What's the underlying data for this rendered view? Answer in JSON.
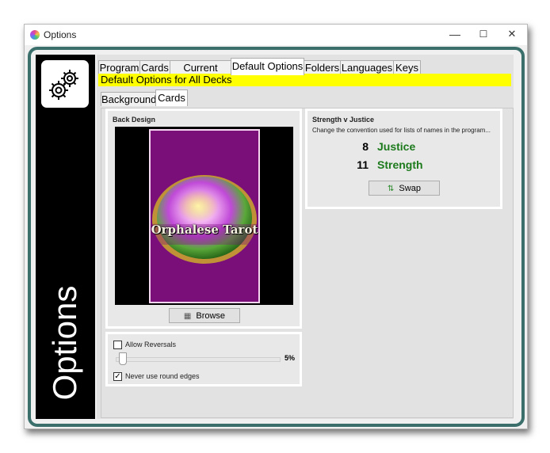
{
  "window": {
    "title": "Options"
  },
  "sidebar": {
    "title": "Options"
  },
  "tabs": [
    "Program",
    "Cards",
    "Current Deck",
    "Default Options",
    "Folders",
    "Languages",
    "Keys"
  ],
  "active_tab": "Default Options",
  "banner": "Default Options for All Decks",
  "subtabs": [
    "Background",
    "Cards"
  ],
  "active_subtab": "Cards",
  "back_design": {
    "label": "Back Design",
    "card_text": "Orphalese Tarot",
    "browse_label": "Browse"
  },
  "reversals": {
    "allow_label": "Allow Reversals",
    "allow_checked": false,
    "percent_value": 5,
    "percent_text": "5%",
    "round_edges_label": "Never use round edges",
    "round_edges_checked": true
  },
  "strength_justice": {
    "label": "Strength v Justice",
    "description": "Change the convention used for lists of names in the program...",
    "rows": [
      {
        "number": "8",
        "name": "Justice"
      },
      {
        "number": "11",
        "name": "Strength"
      }
    ],
    "swap_label": "Swap"
  },
  "colors": {
    "frame": "#3a6f6b",
    "banner": "#ffff00",
    "card_back": "#7a0f7a",
    "card_name": "#1c7a1c"
  },
  "icons": {
    "sidebar": "gears-icon",
    "browse": "folder-icon",
    "swap": "swap-arrows-icon"
  }
}
